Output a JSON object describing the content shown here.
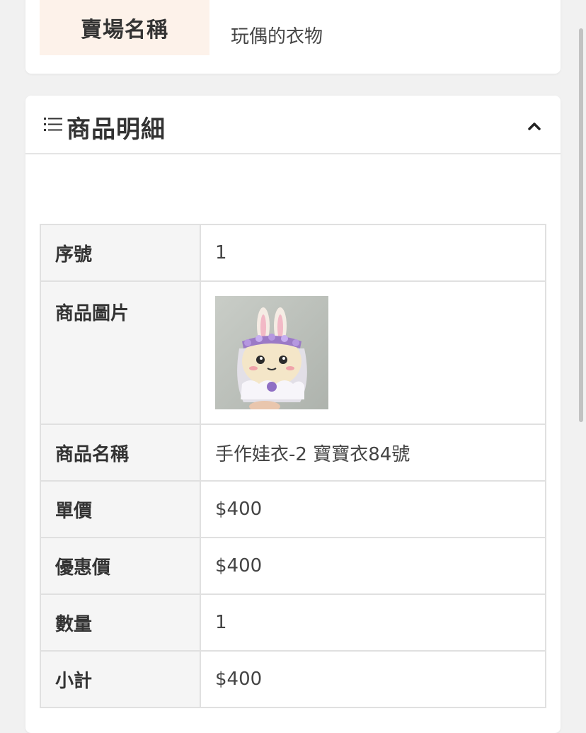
{
  "shop": {
    "label": "賣場名稱",
    "value": "玩偶的衣物"
  },
  "details": {
    "title": "商品明細",
    "list_icon": "list-icon",
    "toggle_icon": "chevron-up-icon",
    "rows": {
      "index": {
        "label": "序號",
        "value": "1"
      },
      "image": {
        "label": "商品圖片",
        "alt": "手作娃衣-2 寶寶衣84號"
      },
      "name": {
        "label": "商品名稱",
        "value": "手作娃衣-2 寶寶衣84號"
      },
      "unit_price": {
        "label": "單價",
        "value": "$400"
      },
      "discount_price": {
        "label": "優惠價",
        "value": "$400"
      },
      "quantity": {
        "label": "數量",
        "value": "1"
      },
      "subtotal": {
        "label": "小計",
        "value": "$400"
      }
    }
  },
  "colors": {
    "label_bg": "#f5f5f5",
    "shop_label_bg": "#fdf2ea",
    "border": "#e0e0e0",
    "page_bg": "#f1f1f1"
  }
}
